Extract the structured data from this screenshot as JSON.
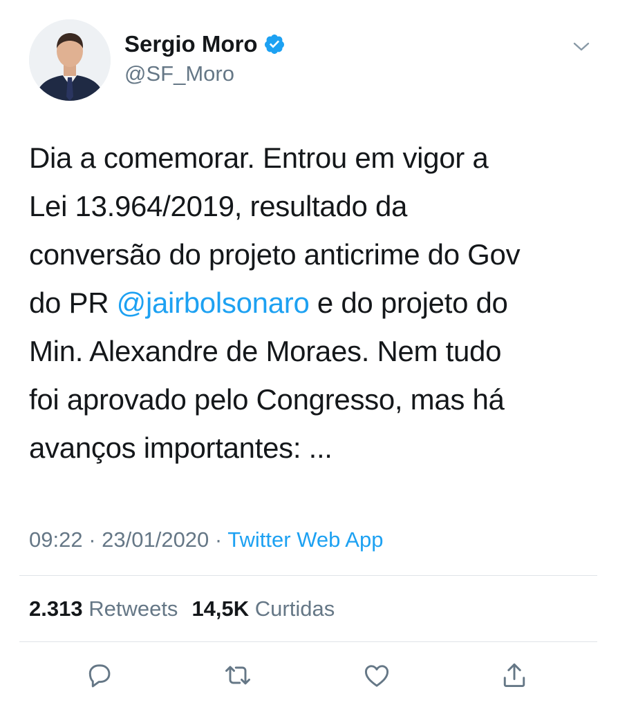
{
  "author": {
    "name": "Sergio Moro",
    "handle": "@SF_Moro",
    "verified": true
  },
  "tweet": {
    "lines": [
      {
        "text": "Dia a comemorar. Entrou em vigor a"
      },
      {
        "text": "Lei 13.964/2019, resultado da"
      },
      {
        "text": "conversão do projeto anticrime do Gov"
      },
      {
        "before": "do PR ",
        "mention": "@jairbolsonaro",
        "after": " e do projeto do"
      },
      {
        "text": "Min. Alexandre de Moraes. Nem tudo"
      },
      {
        "text": "foi aprovado pelo Congresso, mas há"
      },
      {
        "text": "avanços importantes: ..."
      }
    ]
  },
  "meta": {
    "time": "09:22",
    "separator": " · ",
    "date": "23/01/2020",
    "source": "Twitter Web App"
  },
  "stats": {
    "retweets_count": "2.313",
    "retweets_label": "Retweets",
    "likes_count": "14,5K",
    "likes_label": "Curtidas"
  },
  "icons": {
    "more": "chevron-down-icon",
    "verified": "verified-badge-icon",
    "reply": "reply-icon",
    "retweet": "retweet-icon",
    "like": "heart-icon",
    "share": "share-icon"
  },
  "colors": {
    "accent": "#1da1f2",
    "secondary_text": "#657786",
    "primary_text": "#14171a",
    "divider": "#dfe3e7"
  }
}
